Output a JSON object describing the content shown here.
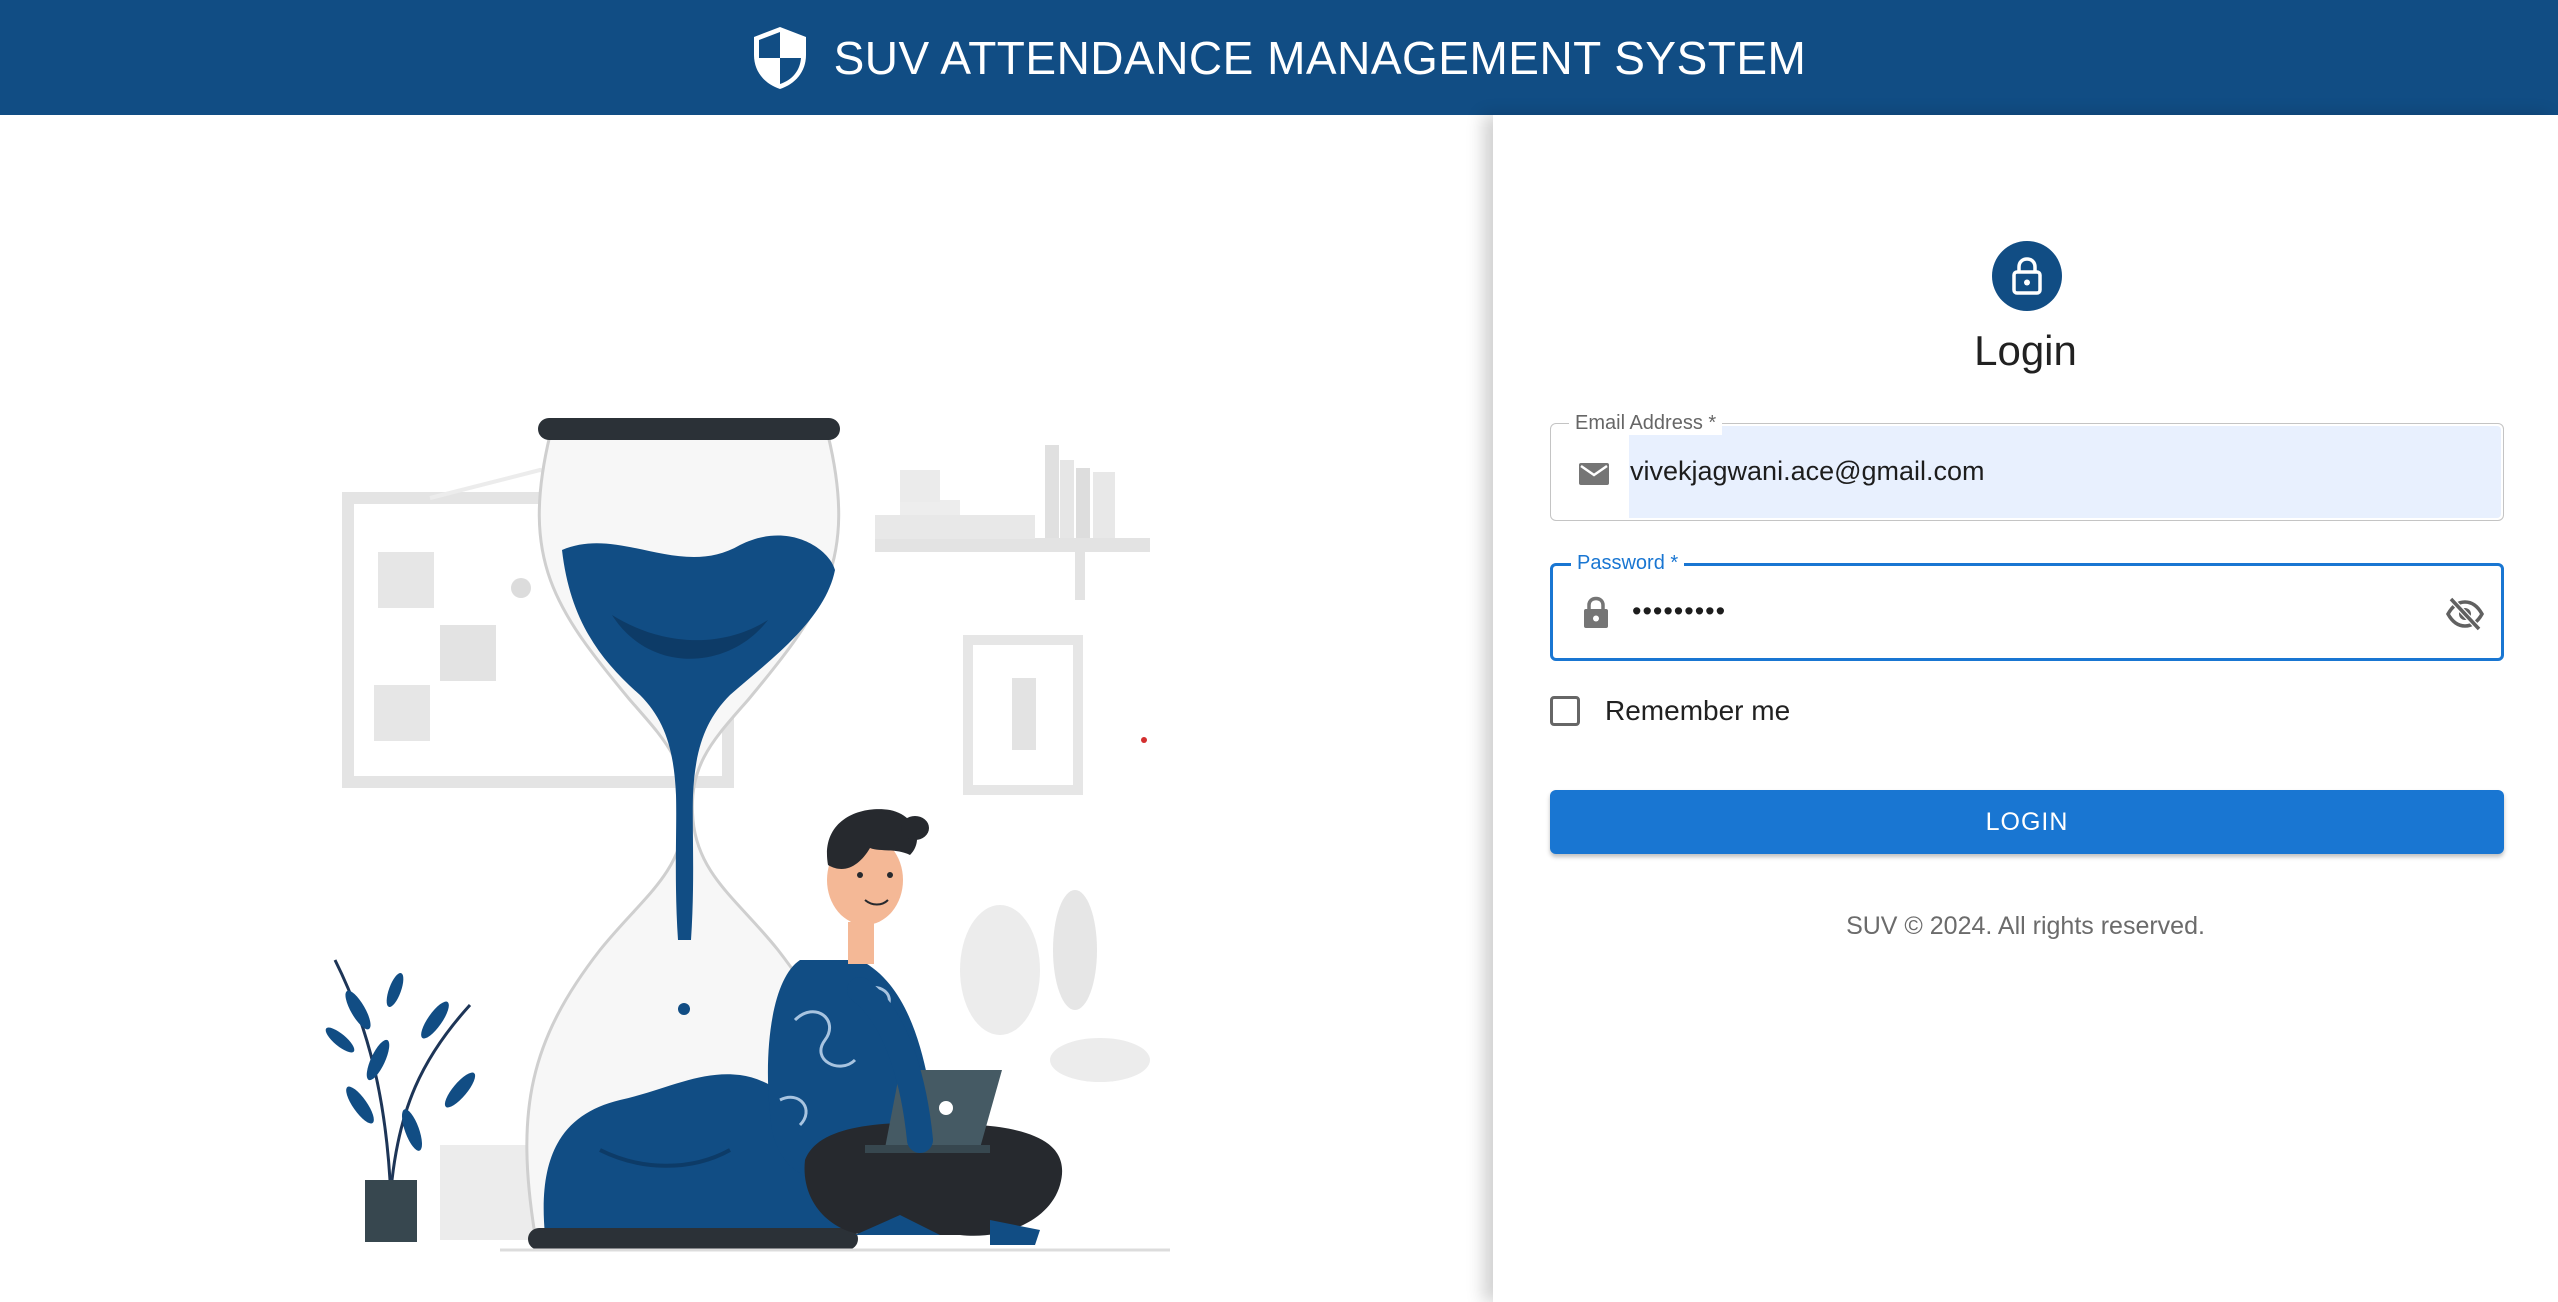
{
  "header": {
    "title": "SUV ATTENDANCE MANAGEMENT SYSTEM",
    "icon": "shield-icon",
    "background_color": "#114d84"
  },
  "illustration": {
    "icon": "hourglass-person-laptop-illustration"
  },
  "login_form": {
    "avatar_icon": "lock-icon",
    "title": "Login",
    "email": {
      "label": "Email Address *",
      "value": "vivekjagwani.ace@gmail.com",
      "icon": "mail-icon"
    },
    "password": {
      "label": "Password *",
      "value": "•••••••••",
      "icon": "lock-icon",
      "toggle_icon": "visibility-off-icon"
    },
    "remember_me": {
      "label": "Remember me",
      "checked": false
    },
    "submit_label": "LOGIN",
    "accent_color": "#1976d2"
  },
  "footer": {
    "text": "SUV © 2024. All rights reserved."
  }
}
